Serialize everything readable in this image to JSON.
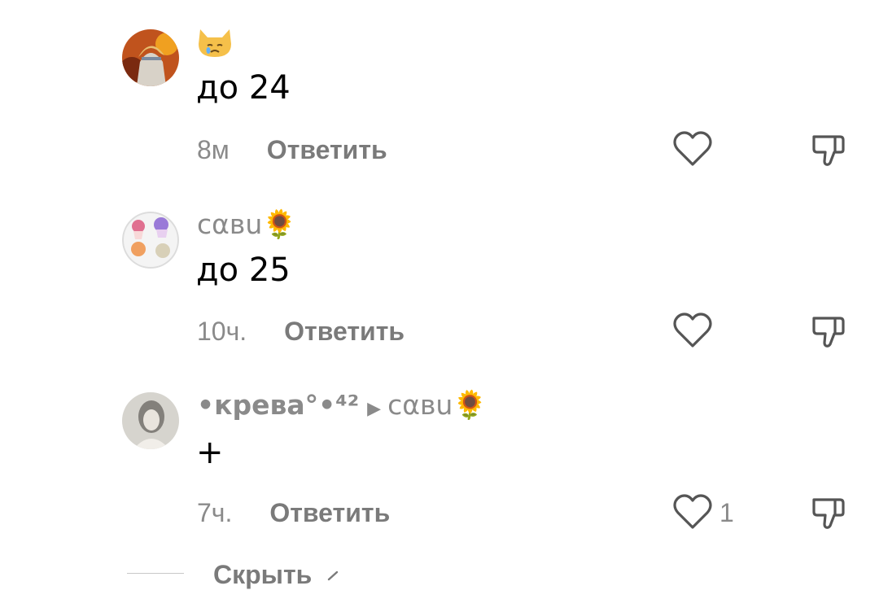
{
  "comments": [
    {
      "username": "",
      "emoji": "😿",
      "text": "до 24",
      "time": "8м",
      "reply_label": "Ответить",
      "likes": ""
    },
    {
      "username": "cαвu",
      "emoji": "🌻",
      "text": "до 25",
      "time": "10ч.",
      "reply_label": "Ответить",
      "likes": ""
    },
    {
      "username": "•крева°•⁴²",
      "reply_to": "cαвu",
      "emoji": "🌻",
      "text": "+",
      "time": "7ч.",
      "reply_label": "Ответить",
      "likes": "1"
    }
  ],
  "hide_label": "Скрыть",
  "icons": {
    "like": "heart-icon",
    "dislike": "thumbs-down-icon",
    "arrow": "caret-right-icon",
    "chevron": "chevron-up-icon"
  },
  "colors": {
    "meta_text": "#8a8a8a",
    "reply_text": "#7a7a7a",
    "icon_stroke": "#555555"
  }
}
